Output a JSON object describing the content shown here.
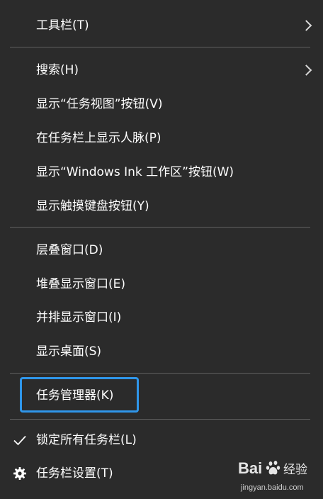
{
  "menu": {
    "items": [
      {
        "label": "工具栏(T)",
        "submenu": true
      },
      {
        "label": "搜索(H)",
        "submenu": true
      },
      {
        "label": "显示“任务视图”按钮(V)"
      },
      {
        "label": "在任务栏上显示人脉(P)"
      },
      {
        "label": "显示“Windows Ink 工作区”按钮(W)"
      },
      {
        "label": "显示触摸键盘按钮(Y)"
      },
      {
        "label": "层叠窗口(D)"
      },
      {
        "label": "堆叠显示窗口(E)"
      },
      {
        "label": "并排显示窗口(I)"
      },
      {
        "label": "显示桌面(S)"
      },
      {
        "label": "任务管理器(K)",
        "highlighted": true
      },
      {
        "label": "锁定所有任务栏(L)",
        "checked": true,
        "icon": "checkmark-icon"
      },
      {
        "label": "任务栏设置(T)",
        "icon": "gear-icon"
      }
    ]
  },
  "watermark": {
    "brand": "Bai百 经验",
    "site": "jingyan.baidu.com"
  },
  "colors": {
    "background": "#2b2b2b",
    "text": "#ffffff",
    "separator": "#5f5f5f",
    "highlight_border": "#2f96ea"
  }
}
